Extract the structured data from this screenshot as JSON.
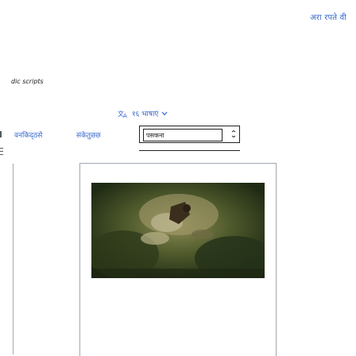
{
  "header": {
    "login_link": "अरा रपते वी"
  },
  "caption": "dic scripts",
  "language_selector": {
    "label": "१६ भाषाएं",
    "icon": "translate-icon",
    "chevron": "chevron-down-icon"
  },
  "nav": {
    "tab_1": "वनकिद्ठसे",
    "tab_2": "संकेतुछछ",
    "select_value": "पसकना"
  },
  "image": {
    "icon": "landscape-photo"
  },
  "colors": {
    "link": "#3366cc",
    "border": "#a2a9b1",
    "text": "#202122"
  }
}
